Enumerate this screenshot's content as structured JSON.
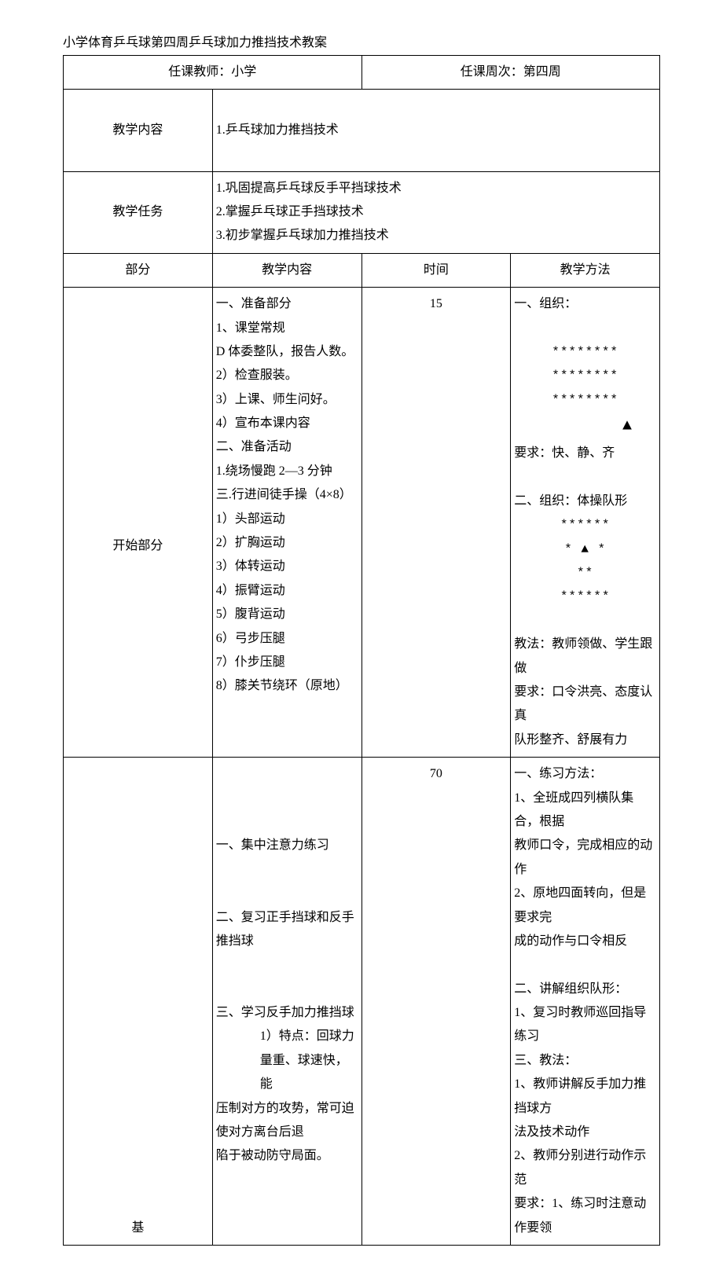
{
  "doc_title": "小学体育乒乓球第四周乒乓球加力推挡技术教案",
  "header": {
    "teacher_label": "任课教师：小学",
    "week_label": "任课周次：第四周"
  },
  "row_labels": {
    "content": "教学内容",
    "task": "教学任务",
    "part": "部分",
    "start": "开始部分",
    "base": "基"
  },
  "teaching_content": {
    "line1": "1.乒乓球加力推挡技术"
  },
  "teaching_task": {
    "line1": "1.巩固提高乒乓球反手平挡球技术",
    "line2": "2.掌握乒乓球正手挡球技术",
    "line3": "3.初步掌握乒乓球加力推挡技术"
  },
  "table_head": {
    "content": "教学内容",
    "time": "时间",
    "method": "教学方法"
  },
  "start_section": {
    "time": "15",
    "content": {
      "l1": "一、准备部分",
      "l2": "1、课堂常规",
      "l3": "D 体委整队，报告人数。",
      "l4": "2）检查服装。",
      "l5": "3）上课、师生问好。",
      "l6": "4）宣布本课内容",
      "l7": "二、准备活动",
      "l8": "1.绕场慢跑 2—3 分钟",
      "l9": "三.行进间徒手操（4×8）",
      "l10": "1）头部运动",
      "l11": "2）扩胸运动",
      "l12": "3）体转运动",
      "l13": "4）振臂运动",
      "l14": "5）腹背运动",
      "l15": "6）弓步压腿",
      "l16": "7）仆步压腿",
      "l17": "8）膝关节绕环（原地）"
    },
    "method": {
      "m1": "一、组织：",
      "f1": "********",
      "f2": "********",
      "f3": "********",
      "f4": "▲",
      "m2": "要求：快、静、齐",
      "m3": "二、组织：体操队形",
      "f5": "******",
      "f6": "* ▲ *",
      "f7": "**",
      "f8": "******",
      "m4": "教法：教师领做、学生跟做",
      "m5": "要求：口令洪亮、态度认真",
      "m6": "队形整齐、舒展有力"
    }
  },
  "base_section": {
    "time": "70",
    "content": {
      "l1": "一、集中注意力练习",
      "l2": "二、复习正手挡球和反手推挡球",
      "l3": "三、学习反手加力推挡球",
      "l4": "1）特点：回球力量重、球速快，能",
      "l5": "压制对方的攻势，常可迫使对方离台后退",
      "l6": "陷于被动防守局面。"
    },
    "method": {
      "m1": "一、练习方法：",
      "m2": "1、全班成四列横队集合，根据",
      "m3": "教师口令，完成相应的动作",
      "m4": "2、原地四面转向，但是要求完",
      "m5": "成的动作与口令相反",
      "m6": "二、讲解组织队形：",
      "m7": "1、复习时教师巡回指导练习",
      "m8": "三、教法：",
      "m9": "1、教师讲解反手加力推挡球方",
      "m10": "法及技术动作",
      "m11": "2、教师分别进行动作示范",
      "m12": "要求：1、练习时注意动作要领"
    }
  }
}
